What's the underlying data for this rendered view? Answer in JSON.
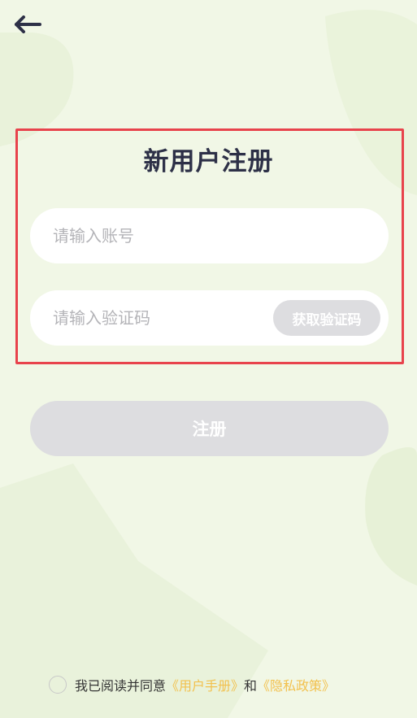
{
  "header": {
    "back_icon": "arrow-left-icon"
  },
  "form": {
    "title": "新用户注册",
    "account_placeholder": "请输入账号",
    "code_placeholder": "请输入验证码",
    "get_code_label": "获取验证码"
  },
  "register_button_label": "注册",
  "agreement": {
    "prefix": "我已阅读并同意",
    "user_manual": "《用户手册》",
    "conjunction": "和",
    "privacy_policy": "《隐私政策》"
  },
  "colors": {
    "background": "#f1f7e6",
    "title": "#2d3047",
    "highlight_border": "#e8434c",
    "disabled_button": "#dddde0",
    "link": "#f2c14e"
  }
}
